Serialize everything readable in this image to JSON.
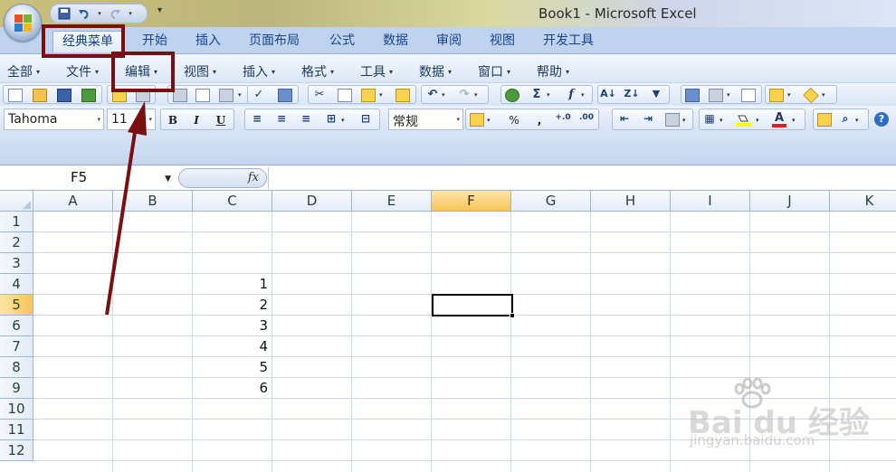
{
  "window": {
    "title": "Book1 - Microsoft Excel"
  },
  "tabs": [
    {
      "label": "经典菜单",
      "active": true
    },
    {
      "label": "开始"
    },
    {
      "label": "插入"
    },
    {
      "label": "页面布局"
    },
    {
      "label": "公式"
    },
    {
      "label": "数据"
    },
    {
      "label": "审阅"
    },
    {
      "label": "视图"
    },
    {
      "label": "开发工具"
    }
  ],
  "menubar": [
    {
      "label": "全部"
    },
    {
      "label": "文件"
    },
    {
      "label": "编辑"
    },
    {
      "label": "视图"
    },
    {
      "label": "插入"
    },
    {
      "label": "格式"
    },
    {
      "label": "工具"
    },
    {
      "label": "数据"
    },
    {
      "label": "窗口"
    },
    {
      "label": "帮助"
    }
  ],
  "format_toolbar": {
    "font_name": "Tahoma",
    "font_size": "11",
    "bold": "B",
    "italic": "I",
    "underline": "U",
    "number_format": "常规",
    "percent": "%",
    "comma": ","
  },
  "formula_bar": {
    "name_box": "F5",
    "fx_label": "fx",
    "formula": ""
  },
  "sheet": {
    "columns": [
      "A",
      "B",
      "C",
      "D",
      "E",
      "F",
      "G",
      "H",
      "I",
      "J",
      "K"
    ],
    "rows": [
      "1",
      "2",
      "3",
      "4",
      "5",
      "6",
      "7",
      "8",
      "9",
      "10",
      "11",
      "12"
    ],
    "selected_column": "F",
    "selected_row": "5",
    "active_cell": "F5",
    "cells": [
      {
        "ref": "C4",
        "value": "1"
      },
      {
        "ref": "C5",
        "value": "2"
      },
      {
        "ref": "C6",
        "value": "3"
      },
      {
        "ref": "C7",
        "value": "4"
      },
      {
        "ref": "C8",
        "value": "5"
      },
      {
        "ref": "C9",
        "value": "6"
      }
    ]
  },
  "watermark": {
    "logo_text": "Bai du 经验",
    "url": "jingyan.baidu.com"
  },
  "colors": {
    "annotation": "#7a0f12",
    "selected_header": "#f8c35b"
  }
}
